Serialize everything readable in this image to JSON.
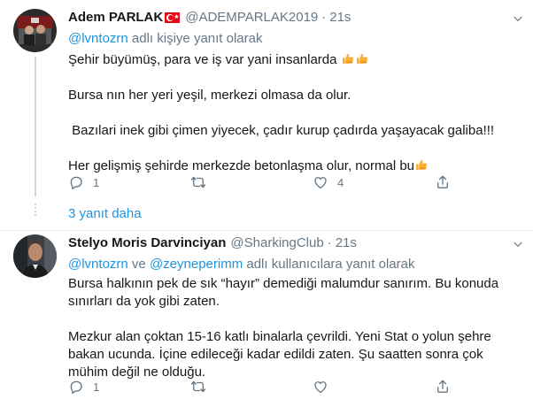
{
  "tweets": [
    {
      "name": "Adem PARLAK",
      "handle": "@ADEMPARLAK2019",
      "separator": "·",
      "time": "21s",
      "reply_prefix": "@lvntozrn",
      "reply_suffix": " adlı kişiye yanıt olarak",
      "lines": [
        "Şehir büyümüş, para ve iş var yani insanlarda",
        "Bursa nın her yeri yeşil, merkezi olmasa da olur.",
        " Bazılari inek gibi çimen yiyecek, çadır kurup çadırda yaşayacak galiba!!!",
        "Her gelişmiş şehirde merkezde betonlaşma olur, normal bu"
      ],
      "reply_count": "1",
      "retweet_count": "",
      "like_count": "4",
      "more_replies": "3 yanıt daha"
    },
    {
      "name": "Stelyo Moris Darvinciyan",
      "handle": "@SharkingClub",
      "separator": "·",
      "time": "21s",
      "reply_user1": "@lvntozrn",
      "reply_mid": " ve ",
      "reply_user2": "@zeyneperimm",
      "reply_suffix": " adlı kullanıcılara yanıt olarak",
      "paragraph1": "Bursa halkının pek de sık “hayır” demediği malumdur sanırım. Bu konuda sınırları da yok gibi zaten.",
      "paragraph2": "Mezkur alan çoktan 15-16 katlı binalarla çevrildi. Yeni Stat o yolun şehre bakan ucunda. İçine edileceği kadar edildi zaten. Şu saatten sonra çok mühim değil ne olduğu.",
      "reply_count": "1",
      "retweet_count": "",
      "like_count": ""
    }
  ],
  "icons": {
    "flag": "turkey-flag-icon",
    "thumbs": "thumbs-up-icon",
    "reply": "reply-icon",
    "retweet": "retweet-icon",
    "like": "heart-icon",
    "share": "share-icon",
    "caret": "chevron-down-icon"
  },
  "colors": {
    "link": "#1b95e0",
    "muted": "#657786",
    "text": "#14171a",
    "thread": "#ccd6dd",
    "thumbs": "#ffac33"
  }
}
